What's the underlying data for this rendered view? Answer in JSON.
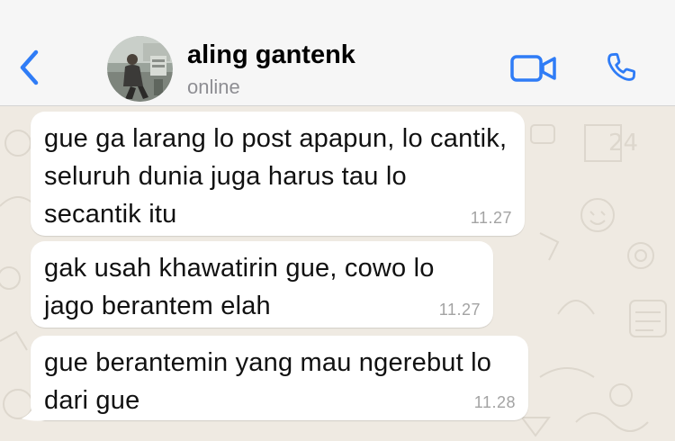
{
  "header": {
    "contact_name": "aling gantenk",
    "status": "online",
    "back_icon": "chevron-left-icon",
    "video_icon": "video-camera-icon",
    "call_icon": "phone-icon",
    "accent_color": "#2f7cf6"
  },
  "chat": {
    "wallpaper_color": "#efeae2",
    "messages": [
      {
        "text": "gue ga larang lo post apapun, lo cantik, seluruh dunia juga harus tau lo secantik itu",
        "time": "11.27"
      },
      {
        "text": "gak usah khawatirin gue, cowo lo jago berantem elah",
        "time": "11.27"
      },
      {
        "text": "gue berantemin yang mau ngerebut lo dari gue",
        "time": "11.28"
      }
    ]
  }
}
